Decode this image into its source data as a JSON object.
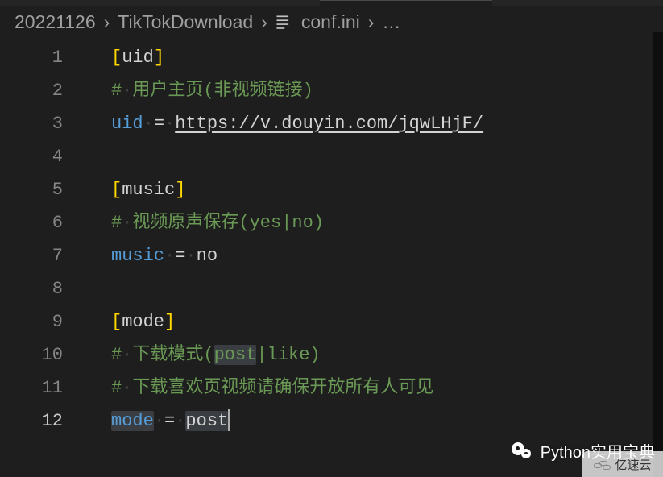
{
  "breadcrumb": {
    "root": "20221126",
    "folder": "TikTokDownload",
    "file": "conf.ini",
    "overflow": "…"
  },
  "code": {
    "l1": {
      "b_open": "[",
      "section": "uid",
      "b_close": "]"
    },
    "l2": {
      "hash": "#",
      "dot": "·",
      "text": "用户主页(非视频链接)"
    },
    "l3": {
      "key": "uid",
      "dot": "·",
      "eq": "=",
      "val": "https://v.douyin.com/jqwLHjF/"
    },
    "l5": {
      "b_open": "[",
      "section": "music",
      "b_close": "]"
    },
    "l6": {
      "hash": "#",
      "dot": "·",
      "text": "视频原声保存(yes|no)"
    },
    "l7": {
      "key": "music",
      "dot": "·",
      "eq": "=",
      "val": "no"
    },
    "l9": {
      "b_open": "[",
      "section": "mode",
      "b_close": "]"
    },
    "l10": {
      "hash": "#",
      "dot": "·",
      "pre": "下载模式(",
      "hl": "post",
      "post": "|like)"
    },
    "l11": {
      "hash": "#",
      "dot": "·",
      "text": "下载喜欢页视频请确保开放所有人可见"
    },
    "l12": {
      "key": "mode",
      "dot": "·",
      "eq": "=",
      "val": "post"
    }
  },
  "line_nums": [
    "1",
    "2",
    "3",
    "4",
    "5",
    "6",
    "7",
    "8",
    "9",
    "10",
    "11",
    "12"
  ],
  "watermark": {
    "text": "Python实用宝典"
  },
  "watermark2": {
    "text": "亿速云"
  }
}
